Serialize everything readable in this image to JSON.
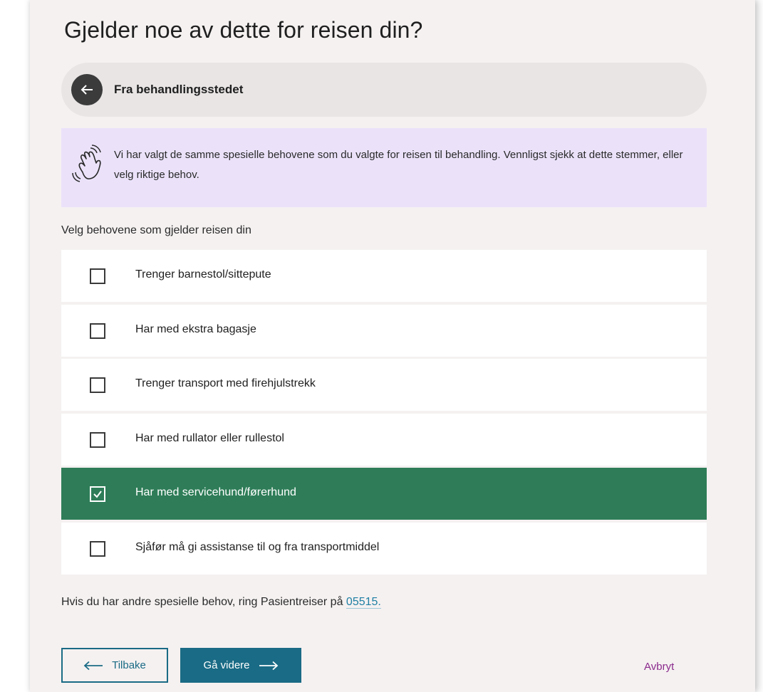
{
  "page": {
    "title": "Gjelder noe av dette for reisen din?"
  },
  "segment": {
    "label": "Fra behandlingsstedet",
    "back_icon": "arrow-left-icon"
  },
  "info": {
    "icon": "waving-hand-icon",
    "text": "Vi har valgt de samme spesielle behovene som du valgte for reisen til behandling. Vennligst sjekk at dette stemmer, eller velg riktige behov."
  },
  "needs": {
    "label": "Velg behovene som gjelder reisen din",
    "options": [
      {
        "label": "Trenger barnestol/sittepute",
        "checked": false
      },
      {
        "label": "Har med ekstra bagasje",
        "checked": false
      },
      {
        "label": "Trenger transport med firehjulstrekk",
        "checked": false
      },
      {
        "label": "Har med rullator eller rullestol",
        "checked": false
      },
      {
        "label": "Har med servicehund/førerhund",
        "checked": true
      },
      {
        "label": "Sjåfør må gi assistanse til og fra transportmiddel",
        "checked": false
      }
    ]
  },
  "help": {
    "text": "Hvis du har andre spesielle behov, ring Pasientreiser på ",
    "phone": "05515."
  },
  "actions": {
    "back_label": "Tilbake",
    "next_label": "Gå videre",
    "cancel_label": "Avbryt"
  },
  "colors": {
    "selected_row": "#2e7d58",
    "primary": "#1a6b85",
    "info_bg": "#ebe2fa",
    "link": "#1f7fa3",
    "cancel": "#8b2a8c"
  }
}
